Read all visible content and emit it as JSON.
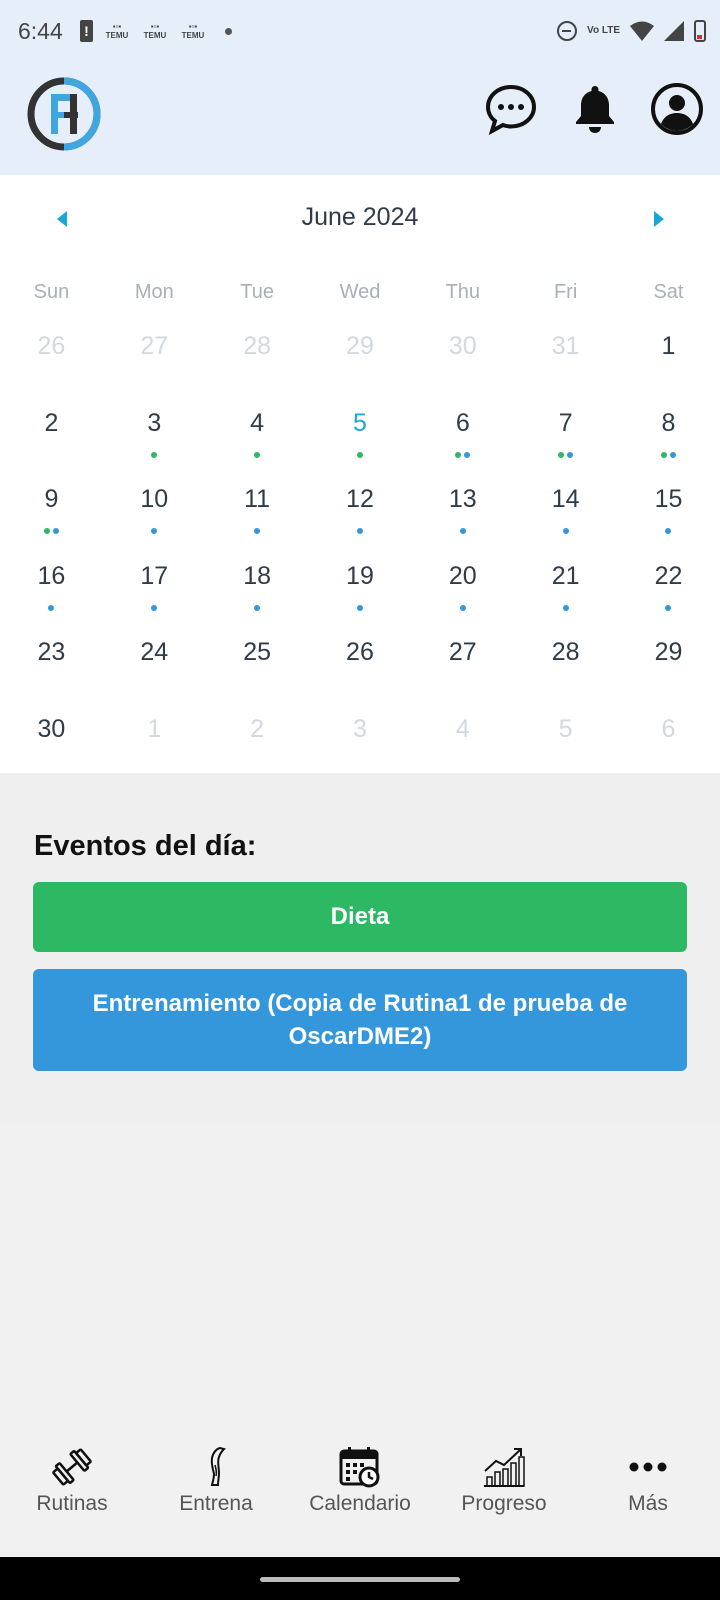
{
  "status_bar": {
    "time": "6:44",
    "temu_label": "TEMU",
    "volte": "Vo LTE",
    "icons": [
      "battery-alert-icon",
      "temu-notification-icon",
      "dnd-icon",
      "wifi-icon",
      "signal-icon",
      "battery-icon"
    ]
  },
  "header": {
    "logo": "app-logo",
    "icons": [
      "chat-icon",
      "bell-icon",
      "user-icon"
    ]
  },
  "calendar": {
    "month_title": "June 2024",
    "weekdays": [
      "Sun",
      "Mon",
      "Tue",
      "Wed",
      "Thu",
      "Fri",
      "Sat"
    ],
    "accent_color": "#1aa7d6",
    "dot_colors": {
      "green": "#2db864",
      "blue": "#3597db"
    },
    "days": [
      {
        "n": "26",
        "outside": true,
        "dots": []
      },
      {
        "n": "27",
        "outside": true,
        "dots": []
      },
      {
        "n": "28",
        "outside": true,
        "dots": []
      },
      {
        "n": "29",
        "outside": true,
        "dots": []
      },
      {
        "n": "30",
        "outside": true,
        "dots": []
      },
      {
        "n": "31",
        "outside": true,
        "dots": []
      },
      {
        "n": "1",
        "dots": []
      },
      {
        "n": "2",
        "dots": []
      },
      {
        "n": "3",
        "dots": [
          "green"
        ]
      },
      {
        "n": "4",
        "dots": [
          "green"
        ]
      },
      {
        "n": "5",
        "today": true,
        "dots": [
          "green"
        ]
      },
      {
        "n": "6",
        "dots": [
          "green",
          "blue"
        ]
      },
      {
        "n": "7",
        "dots": [
          "green",
          "blue"
        ]
      },
      {
        "n": "8",
        "dots": [
          "green",
          "blue"
        ]
      },
      {
        "n": "9",
        "dots": [
          "green",
          "blue"
        ]
      },
      {
        "n": "10",
        "dots": [
          "blue"
        ]
      },
      {
        "n": "11",
        "dots": [
          "blue"
        ]
      },
      {
        "n": "12",
        "dots": [
          "blue"
        ]
      },
      {
        "n": "13",
        "dots": [
          "blue"
        ]
      },
      {
        "n": "14",
        "dots": [
          "blue"
        ]
      },
      {
        "n": "15",
        "dots": [
          "blue"
        ]
      },
      {
        "n": "16",
        "dots": [
          "blue"
        ]
      },
      {
        "n": "17",
        "dots": [
          "blue"
        ]
      },
      {
        "n": "18",
        "dots": [
          "blue"
        ]
      },
      {
        "n": "19",
        "dots": [
          "blue"
        ]
      },
      {
        "n": "20",
        "dots": [
          "blue"
        ]
      },
      {
        "n": "21",
        "dots": [
          "blue"
        ]
      },
      {
        "n": "22",
        "dots": [
          "blue"
        ]
      },
      {
        "n": "23",
        "dots": []
      },
      {
        "n": "24",
        "dots": []
      },
      {
        "n": "25",
        "dots": []
      },
      {
        "n": "26",
        "dots": []
      },
      {
        "n": "27",
        "dots": []
      },
      {
        "n": "28",
        "dots": []
      },
      {
        "n": "29",
        "dots": []
      },
      {
        "n": "30",
        "dots": []
      },
      {
        "n": "1",
        "outside": true,
        "dots": []
      },
      {
        "n": "2",
        "outside": true,
        "dots": []
      },
      {
        "n": "3",
        "outside": true,
        "dots": []
      },
      {
        "n": "4",
        "outside": true,
        "dots": []
      },
      {
        "n": "5",
        "outside": true,
        "dots": []
      },
      {
        "n": "6",
        "outside": true,
        "dots": []
      }
    ]
  },
  "events": {
    "title": "Eventos del día:",
    "items": [
      {
        "label": "Dieta",
        "color": "#2db864"
      },
      {
        "label": "Entrenamiento (Copia de Rutina1 de prueba de OscarDME2)",
        "color": "#3597db"
      }
    ]
  },
  "bottom_nav": {
    "items": [
      {
        "label": "Rutinas",
        "icon": "dumbbell-icon"
      },
      {
        "label": "Entrena",
        "icon": "leg-icon"
      },
      {
        "label": "Calendario",
        "icon": "calendar-clock-icon"
      },
      {
        "label": "Progreso",
        "icon": "progress-chart-icon"
      },
      {
        "label": "Más",
        "icon": "more-icon"
      }
    ]
  }
}
